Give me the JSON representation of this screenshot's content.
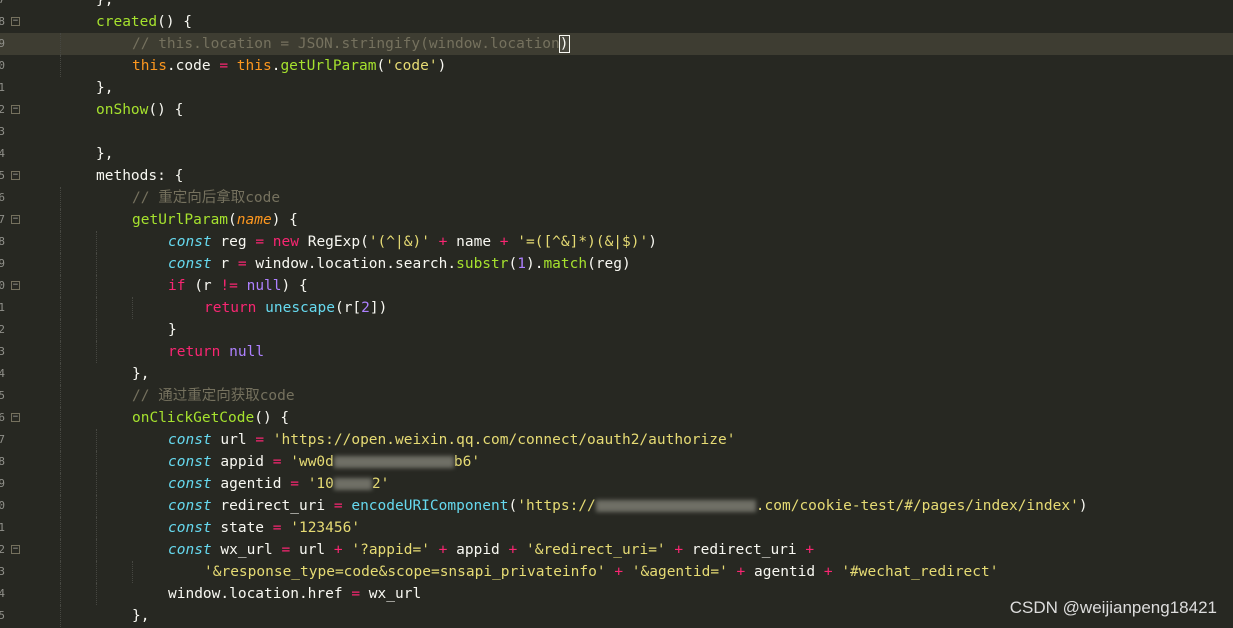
{
  "editor": {
    "theme_colors": {
      "background": "#272822",
      "current_line": "#3E3D32",
      "keyword": "#F92672",
      "string": "#E6DB74",
      "function": "#A6E22E",
      "type": "#66D9EF",
      "comment": "#75715E",
      "constant": "#AE81FF"
    },
    "current_line_index": 2,
    "lines": [
      {
        "ln": "7",
        "fold": "",
        "indent": 2,
        "tokens": [
          {
            "t": "},",
            "c": "pl"
          }
        ]
      },
      {
        "ln": "8",
        "fold": "minus",
        "indent": 2,
        "tokens": [
          {
            "t": "created",
            "c": "fn"
          },
          {
            "t": "() {",
            "c": "pl"
          }
        ]
      },
      {
        "ln": "9",
        "fold": "",
        "indent": 3,
        "tokens": [
          {
            "t": "// this.location = JSON.stringify(",
            "c": "co"
          },
          {
            "t": "window.location",
            "c": "co"
          },
          {
            "t": ")",
            "c": "bm"
          }
        ]
      },
      {
        "ln": "0",
        "fold": "",
        "indent": 3,
        "tokens": [
          {
            "t": "this",
            "c": "th"
          },
          {
            "t": ".code ",
            "c": "pl"
          },
          {
            "t": "=",
            "c": "kw"
          },
          {
            "t": " ",
            "c": "pl"
          },
          {
            "t": "this",
            "c": "th"
          },
          {
            "t": ".",
            "c": "pl"
          },
          {
            "t": "getUrlParam",
            "c": "fn"
          },
          {
            "t": "(",
            "c": "pl"
          },
          {
            "t": "'code'",
            "c": "st"
          },
          {
            "t": ")",
            "c": "pl"
          }
        ]
      },
      {
        "ln": "1",
        "fold": "",
        "indent": 2,
        "tokens": [
          {
            "t": "},",
            "c": "pl"
          }
        ]
      },
      {
        "ln": "2",
        "fold": "minus",
        "indent": 2,
        "tokens": [
          {
            "t": "onShow",
            "c": "fn"
          },
          {
            "t": "() {",
            "c": "pl"
          }
        ]
      },
      {
        "ln": "3",
        "fold": "",
        "indent": 0,
        "tokens": []
      },
      {
        "ln": "4",
        "fold": "",
        "indent": 2,
        "tokens": [
          {
            "t": "},",
            "c": "pl"
          }
        ]
      },
      {
        "ln": "5",
        "fold": "minus",
        "indent": 2,
        "tokens": [
          {
            "t": "methods: {",
            "c": "pl"
          }
        ]
      },
      {
        "ln": "6",
        "fold": "",
        "indent": 3,
        "tokens": [
          {
            "t": "// 重定向后拿取code",
            "c": "co"
          }
        ]
      },
      {
        "ln": "7",
        "fold": "minus",
        "indent": 3,
        "tokens": [
          {
            "t": "getUrlParam",
            "c": "fn"
          },
          {
            "t": "(",
            "c": "pl"
          },
          {
            "t": "name",
            "c": "pa"
          },
          {
            "t": ") {",
            "c": "pl"
          }
        ]
      },
      {
        "ln": "8",
        "fold": "",
        "indent": 4,
        "tokens": [
          {
            "t": "const",
            "c": "ty"
          },
          {
            "t": " reg ",
            "c": "pl"
          },
          {
            "t": "=",
            "c": "kw"
          },
          {
            "t": " ",
            "c": "pl"
          },
          {
            "t": "new",
            "c": "kw"
          },
          {
            "t": " RegExp(",
            "c": "pl"
          },
          {
            "t": "'(^|&)'",
            "c": "st"
          },
          {
            "t": " ",
            "c": "pl"
          },
          {
            "t": "+",
            "c": "kw"
          },
          {
            "t": " name ",
            "c": "pl"
          },
          {
            "t": "+",
            "c": "kw"
          },
          {
            "t": " ",
            "c": "pl"
          },
          {
            "t": "'=([^&]*)(&|$)'",
            "c": "st"
          },
          {
            "t": ")",
            "c": "pl"
          }
        ]
      },
      {
        "ln": "9",
        "fold": "",
        "indent": 4,
        "tokens": [
          {
            "t": "const",
            "c": "ty"
          },
          {
            "t": " r ",
            "c": "pl"
          },
          {
            "t": "=",
            "c": "kw"
          },
          {
            "t": " window.location.search.",
            "c": "pl"
          },
          {
            "t": "substr",
            "c": "fn"
          },
          {
            "t": "(",
            "c": "pl"
          },
          {
            "t": "1",
            "c": "cn"
          },
          {
            "t": ").",
            "c": "pl"
          },
          {
            "t": "match",
            "c": "fn"
          },
          {
            "t": "(reg)",
            "c": "pl"
          }
        ]
      },
      {
        "ln": "0",
        "fold": "minus",
        "indent": 4,
        "tokens": [
          {
            "t": "if",
            "c": "kw"
          },
          {
            "t": " (r ",
            "c": "pl"
          },
          {
            "t": "!=",
            "c": "kw"
          },
          {
            "t": " ",
            "c": "pl"
          },
          {
            "t": "null",
            "c": "cn"
          },
          {
            "t": ") {",
            "c": "pl"
          }
        ]
      },
      {
        "ln": "1",
        "fold": "",
        "indent": 5,
        "tokens": [
          {
            "t": "return",
            "c": "kw"
          },
          {
            "t": " ",
            "c": "pl"
          },
          {
            "t": "unescape",
            "c": "bi"
          },
          {
            "t": "(r[",
            "c": "pl"
          },
          {
            "t": "2",
            "c": "cn"
          },
          {
            "t": "])",
            "c": "pl"
          }
        ]
      },
      {
        "ln": "2",
        "fold": "",
        "indent": 4,
        "tokens": [
          {
            "t": "}",
            "c": "pl"
          }
        ]
      },
      {
        "ln": "3",
        "fold": "",
        "indent": 4,
        "tokens": [
          {
            "t": "return",
            "c": "kw"
          },
          {
            "t": " ",
            "c": "pl"
          },
          {
            "t": "null",
            "c": "cn"
          }
        ]
      },
      {
        "ln": "4",
        "fold": "",
        "indent": 3,
        "tokens": [
          {
            "t": "},",
            "c": "pl"
          }
        ]
      },
      {
        "ln": "5",
        "fold": "",
        "indent": 3,
        "tokens": [
          {
            "t": "// 通过重定向获取code",
            "c": "co"
          }
        ]
      },
      {
        "ln": "6",
        "fold": "minus",
        "indent": 3,
        "tokens": [
          {
            "t": "onClickGetCode",
            "c": "fn"
          },
          {
            "t": "() {",
            "c": "pl"
          }
        ]
      },
      {
        "ln": "7",
        "fold": "",
        "indent": 4,
        "tokens": [
          {
            "t": "const",
            "c": "ty"
          },
          {
            "t": " url ",
            "c": "pl"
          },
          {
            "t": "=",
            "c": "kw"
          },
          {
            "t": " ",
            "c": "pl"
          },
          {
            "t": "'https://open.weixin.qq.com/connect/oauth2/authorize'",
            "c": "st"
          }
        ]
      },
      {
        "ln": "8",
        "fold": "",
        "indent": 4,
        "tokens": [
          {
            "t": "const",
            "c": "ty"
          },
          {
            "t": " appid ",
            "c": "pl"
          },
          {
            "t": "=",
            "c": "kw"
          },
          {
            "t": " ",
            "c": "pl"
          },
          {
            "t": "'ww0d",
            "c": "st"
          },
          {
            "t": "",
            "c": "blur",
            "w": 120
          },
          {
            "t": "b6'",
            "c": "st"
          }
        ]
      },
      {
        "ln": "9",
        "fold": "",
        "indent": 4,
        "tokens": [
          {
            "t": "const",
            "c": "ty"
          },
          {
            "t": " agentid ",
            "c": "pl"
          },
          {
            "t": "=",
            "c": "kw"
          },
          {
            "t": " ",
            "c": "pl"
          },
          {
            "t": "'10",
            "c": "st"
          },
          {
            "t": "",
            "c": "blur",
            "w": 38
          },
          {
            "t": "2'",
            "c": "st"
          }
        ]
      },
      {
        "ln": "0",
        "fold": "",
        "indent": 4,
        "tokens": [
          {
            "t": "const",
            "c": "ty"
          },
          {
            "t": " redirect_uri ",
            "c": "pl"
          },
          {
            "t": "=",
            "c": "kw"
          },
          {
            "t": " ",
            "c": "pl"
          },
          {
            "t": "encodeURIComponent",
            "c": "bi"
          },
          {
            "t": "(",
            "c": "pl"
          },
          {
            "t": "'https://",
            "c": "st"
          },
          {
            "t": "",
            "c": "blur",
            "w": 160
          },
          {
            "t": ".com/cookie-test/#/pages/index/index'",
            "c": "st"
          },
          {
            "t": ")",
            "c": "pl"
          }
        ]
      },
      {
        "ln": "1",
        "fold": "",
        "indent": 4,
        "tokens": [
          {
            "t": "const",
            "c": "ty"
          },
          {
            "t": " state ",
            "c": "pl"
          },
          {
            "t": "=",
            "c": "kw"
          },
          {
            "t": " ",
            "c": "pl"
          },
          {
            "t": "'123456'",
            "c": "st"
          }
        ]
      },
      {
        "ln": "2",
        "fold": "minus",
        "indent": 4,
        "tokens": [
          {
            "t": "const",
            "c": "ty"
          },
          {
            "t": " wx_url ",
            "c": "pl"
          },
          {
            "t": "=",
            "c": "kw"
          },
          {
            "t": " url ",
            "c": "pl"
          },
          {
            "t": "+",
            "c": "kw"
          },
          {
            "t": " ",
            "c": "pl"
          },
          {
            "t": "'?appid='",
            "c": "st"
          },
          {
            "t": " ",
            "c": "pl"
          },
          {
            "t": "+",
            "c": "kw"
          },
          {
            "t": " appid ",
            "c": "pl"
          },
          {
            "t": "+",
            "c": "kw"
          },
          {
            "t": " ",
            "c": "pl"
          },
          {
            "t": "'&redirect_uri='",
            "c": "st"
          },
          {
            "t": " ",
            "c": "pl"
          },
          {
            "t": "+",
            "c": "kw"
          },
          {
            "t": " redirect_uri ",
            "c": "pl"
          },
          {
            "t": "+",
            "c": "kw"
          }
        ]
      },
      {
        "ln": "3",
        "fold": "",
        "indent": 5,
        "tokens": [
          {
            "t": "'&response_type=code&scope=snsapi_privateinfo'",
            "c": "st"
          },
          {
            "t": " ",
            "c": "pl"
          },
          {
            "t": "+",
            "c": "kw"
          },
          {
            "t": " ",
            "c": "pl"
          },
          {
            "t": "'&agentid='",
            "c": "st"
          },
          {
            "t": " ",
            "c": "pl"
          },
          {
            "t": "+",
            "c": "kw"
          },
          {
            "t": " agentid ",
            "c": "pl"
          },
          {
            "t": "+",
            "c": "kw"
          },
          {
            "t": " ",
            "c": "pl"
          },
          {
            "t": "'#wechat_redirect'",
            "c": "st"
          }
        ]
      },
      {
        "ln": "4",
        "fold": "",
        "indent": 4,
        "tokens": [
          {
            "t": "window.location.href ",
            "c": "pl"
          },
          {
            "t": "=",
            "c": "kw"
          },
          {
            "t": " wx_url",
            "c": "pl"
          }
        ]
      },
      {
        "ln": "5",
        "fold": "",
        "indent": 3,
        "tokens": [
          {
            "t": "},",
            "c": "pl"
          }
        ]
      }
    ]
  },
  "watermark": {
    "text": "CSDN @weijianpeng18421"
  }
}
